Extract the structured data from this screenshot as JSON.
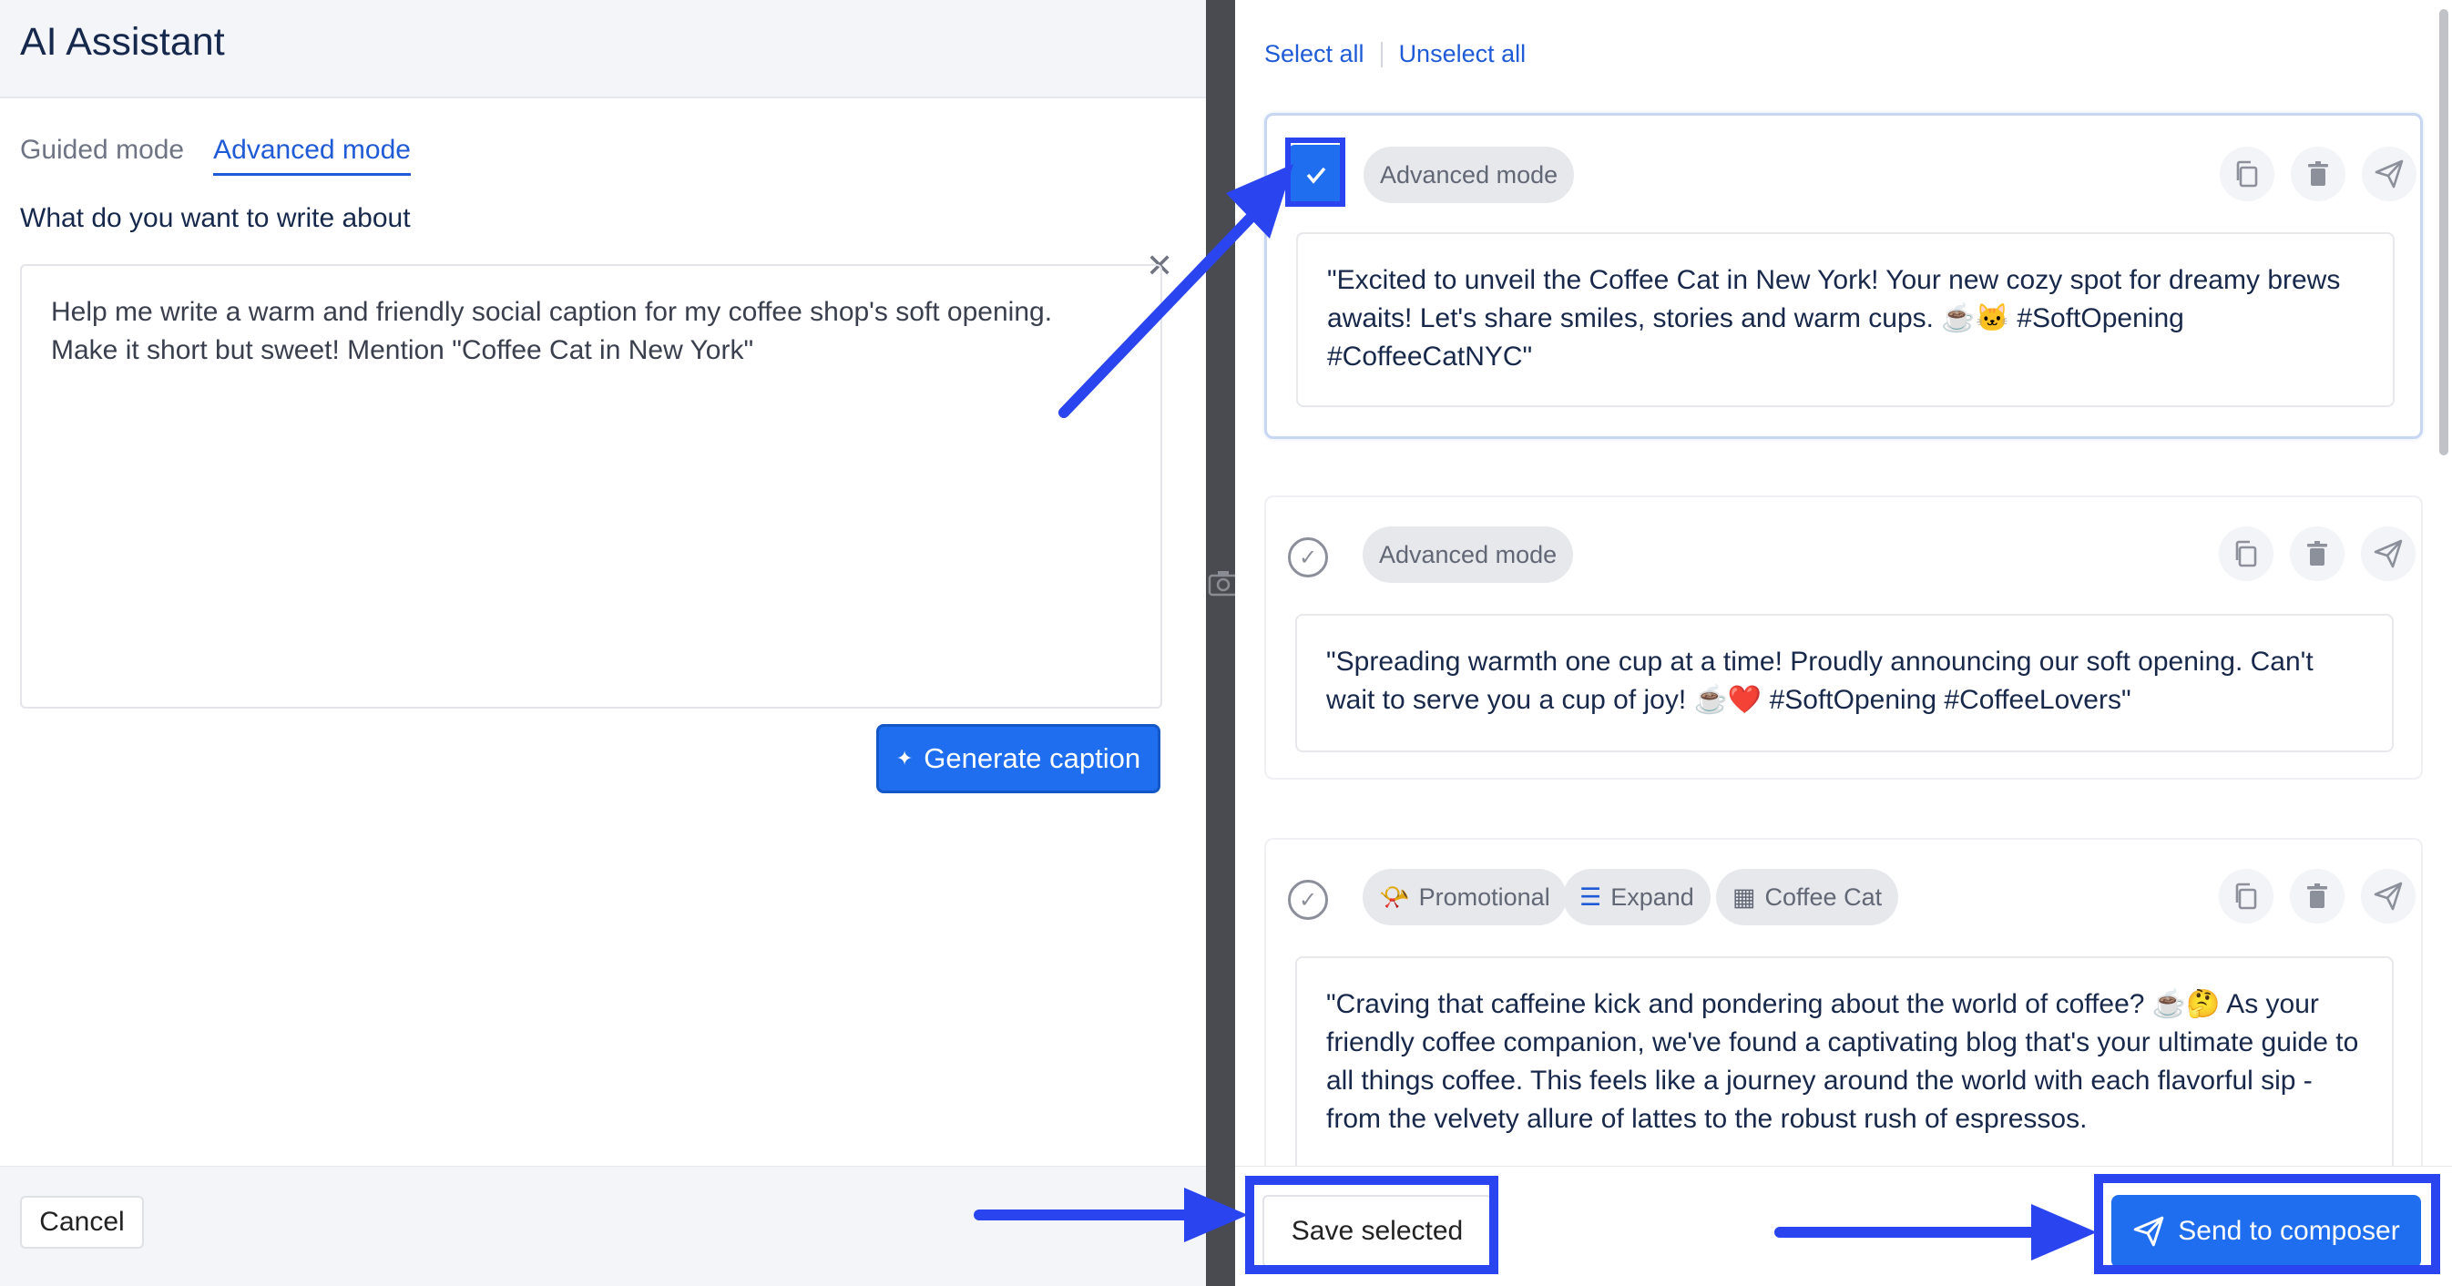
{
  "left": {
    "title": "AI Assistant",
    "tabs": [
      {
        "label": "Guided mode",
        "active": false
      },
      {
        "label": "Advanced mode",
        "active": true
      }
    ],
    "prompt_label": "What do you want to write about",
    "prompt_text": "Help me write a warm and friendly social caption for my coffee shop's soft opening.\nMake it short but sweet! Mention \"Coffee Cat in New York\"",
    "clear_icon": "✕",
    "generate_label": "Generate caption",
    "generate_icon": "✦",
    "cancel_label": "Cancel"
  },
  "right": {
    "select_all": "Select all",
    "unselect_all": "Unselect all",
    "cards": [
      {
        "selected": true,
        "tags": [
          {
            "label": "Advanced mode",
            "icon": ""
          }
        ],
        "caption": "\"Excited to unveil the Coffee Cat in New York! Your new cozy spot for dreamy brews awaits! Let's share smiles, stories and warm cups. ☕🐱 #SoftOpening #CoffeeCatNYC\""
      },
      {
        "selected": false,
        "tags": [
          {
            "label": "Advanced mode",
            "icon": ""
          }
        ],
        "caption": "\"Spreading warmth one cup at a time! Proudly announcing our soft opening. Can't wait to serve you a cup of joy! ☕❤️ #SoftOpening #CoffeeLovers\""
      },
      {
        "selected": false,
        "tags": [
          {
            "label": "Promotional",
            "icon": "📯"
          },
          {
            "label": "Expand",
            "icon": "☰"
          },
          {
            "label": "Coffee Cat",
            "icon": "▦"
          }
        ],
        "caption": "\"Craving that caffeine kick and pondering about the world of coffee? ☕🤔 As your friendly coffee companion, we've found a captivating blog that's your ultimate guide to all things coffee. This feels like a journey around the world with each flavorful sip - from the velvety allure of lattes to the robust rush of espressos."
      }
    ],
    "save_label": "Save selected",
    "send_label": "Send to composer"
  },
  "colors": {
    "accent": "#1f6ef0",
    "annotation": "#2a45f0"
  }
}
